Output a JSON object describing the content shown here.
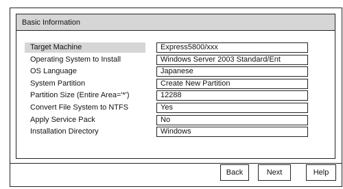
{
  "panel": {
    "title": "Basic Information"
  },
  "rows": [
    {
      "label": "Target Machine",
      "value": "Express5800/xxx"
    },
    {
      "label": "Operating System to Install",
      "value": "Windows Server 2003 Standard/Ent"
    },
    {
      "label": "OS Language",
      "value": "Japanese"
    },
    {
      "label": "System Partition",
      "value": "Create New Partition"
    },
    {
      "label": "Partition Size (Entire Area='*')",
      "value": "12288"
    },
    {
      "label": "Convert File System to NTFS",
      "value": "Yes"
    },
    {
      "label": "Apply Service Pack",
      "value": "No"
    },
    {
      "label": "Installation Directory",
      "value": "Windows"
    }
  ],
  "buttons": {
    "back": "Back",
    "next": "Next",
    "help": "Help"
  },
  "colors": {
    "header_bg": "#d6d6d6",
    "highlight_bg": "#d6d6d6",
    "border": "#222222"
  }
}
